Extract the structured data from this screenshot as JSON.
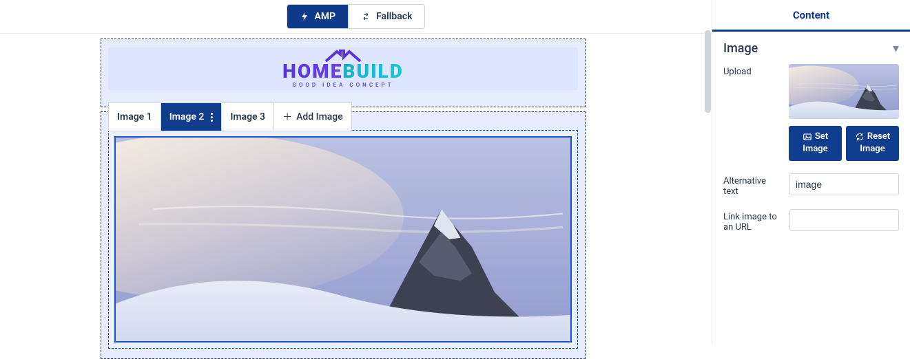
{
  "toolbar": {
    "amp_label": "AMP",
    "fallback_label": "Fallback"
  },
  "logo": {
    "word_left": "HOME",
    "word_right": "BUILD",
    "tagline": "GOOD IDEA CONCEPT"
  },
  "carousel": {
    "tabs": [
      "Image 1",
      "Image 2",
      "Image 3"
    ],
    "active_index": 1,
    "add_label": "Add Image"
  },
  "panel": {
    "tab_label": "Content",
    "section_title": "Image",
    "fields": {
      "upload_label": "Upload",
      "set_image_btn": "Set Image",
      "reset_image_btn": "Reset Image",
      "alt_label": "Alternative text",
      "alt_value": "image",
      "link_label": "Link image to an URL",
      "link_value": ""
    }
  }
}
